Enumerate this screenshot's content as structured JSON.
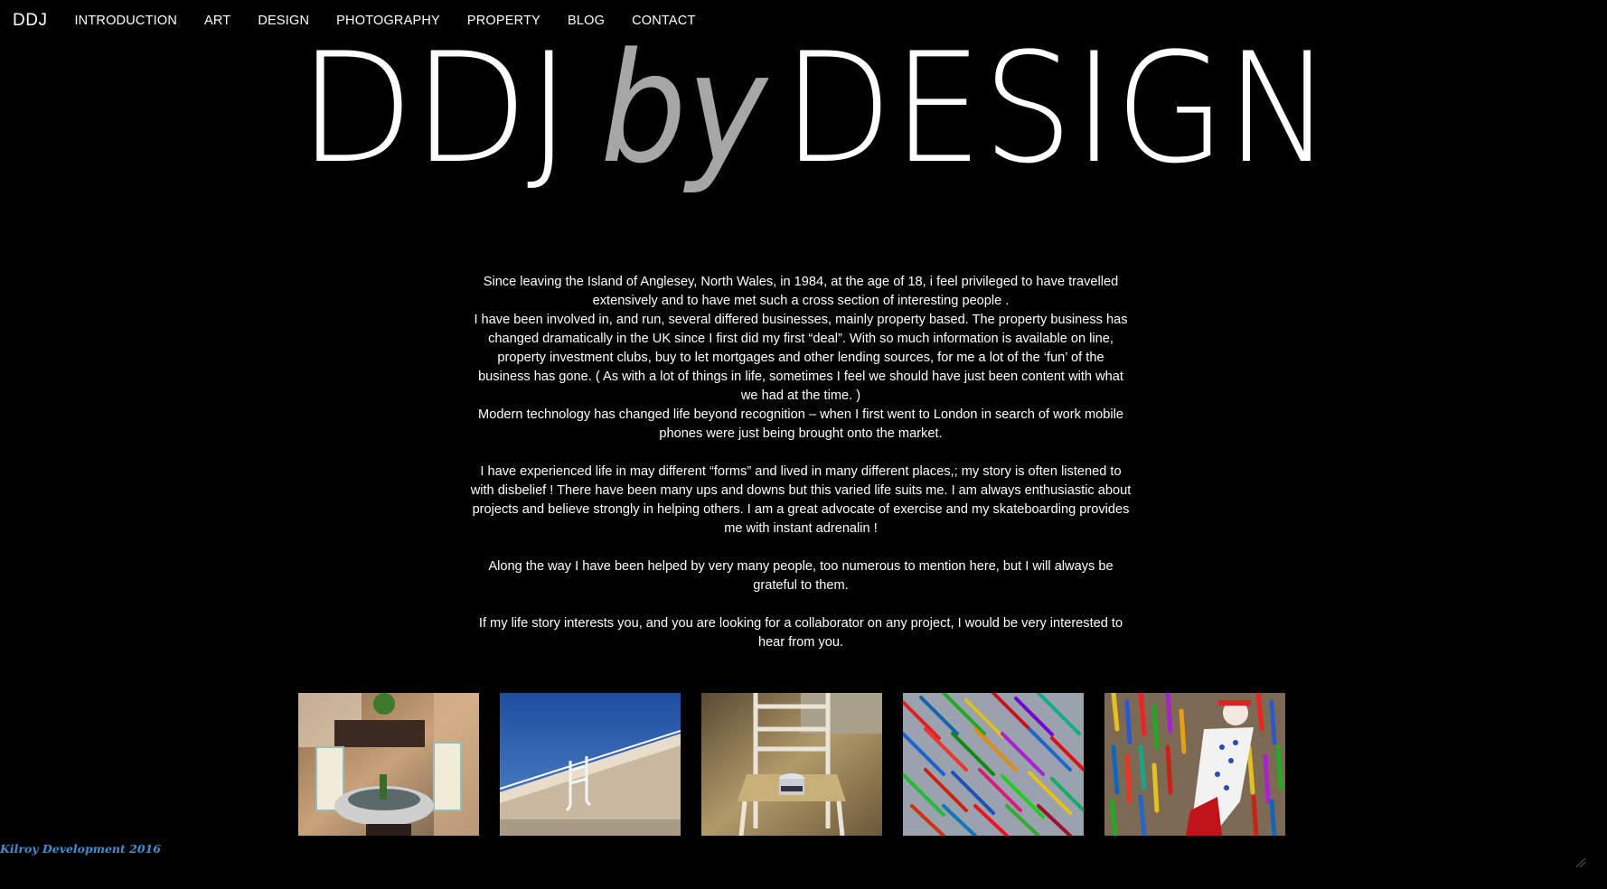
{
  "nav": {
    "brand": "DDJ",
    "items": [
      {
        "label": "INTRODUCTION"
      },
      {
        "label": "ART"
      },
      {
        "label": "DESIGN"
      },
      {
        "label": "PHOTOGRAPHY"
      },
      {
        "label": "PROPERTY"
      },
      {
        "label": "BLOG"
      },
      {
        "label": "CONTACT"
      }
    ]
  },
  "hero": {
    "part1": "DDJ",
    "part2": "by",
    "part3": "DESIGN"
  },
  "bio": {
    "p1": "Since leaving the Island of Anglesey, North Wales, in 1984, at the age of 18, i feel privileged to have travelled extensively and to have met such a cross section of interesting people .",
    "p2": "I have been involved in, and run, several differed businesses, mainly property based. The property business has changed dramatically in the UK since I first did my first “deal”. With so much information is available on line, property investment clubs, buy to let mortgages and other lending sources, for me a lot of the ‘fun’ of the business has gone. ( As with a lot of things in life, sometimes I feel we should have just been content with what we had at the time. )",
    "p3": "Modern technology has changed life beyond recognition – when I first went to London in search of work mobile phones were just being brought onto the market.",
    "p4": "I have experienced life in may different “forms” and lived in many different places,; my story is often listened to with disbelief ! There have been many ups and downs but this varied life suits me. I am always enthusiastic about projects and believe strongly in helping others. I am a great advocate of exercise and my skateboarding provides me with instant adrenalin !",
    "p5": "Along the way I have been helped by very many people, too numerous to mention here, but I will always be grateful to them.",
    "p6": "If my life story interests you, and you are looking for a collaborator on any project, I would be very interested to hear from you."
  },
  "gallery": [
    {
      "name": "patio-chairs-photo"
    },
    {
      "name": "chair-on-roof-photo"
    },
    {
      "name": "rush-chair-photo"
    },
    {
      "name": "diagonal-strokes-painting"
    },
    {
      "name": "figure-painting"
    }
  ],
  "footer": {
    "credit": "Kilroy Development 2016"
  },
  "colors": {
    "background": "#000000",
    "text": "#ffffff",
    "hero_accent": "#a6a6a6",
    "footer_link": "#3f8fd6"
  }
}
